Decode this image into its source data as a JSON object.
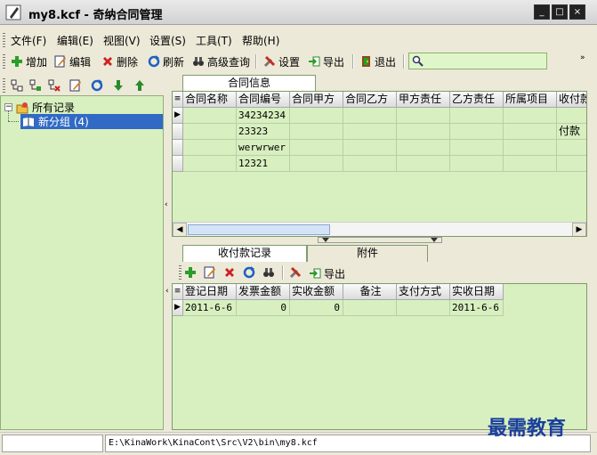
{
  "window": {
    "title": "my8.kcf - 奇纳合同管理"
  },
  "menu": [
    "文件(F)",
    "编辑(E)",
    "视图(V)",
    "设置(S)",
    "工具(T)",
    "帮助(H)"
  ],
  "toolbar": {
    "add": "增加",
    "edit": "编辑",
    "delete": "删除",
    "refresh": "刷新",
    "advanced_search": "高级查询",
    "settings": "设置",
    "export": "导出",
    "exit": "退出"
  },
  "tree": {
    "root": "所有记录",
    "group": "新分组 (4)"
  },
  "top_panel": {
    "tab": "合同信息",
    "columns": [
      "合同名称",
      "合同编号",
      "合同甲方",
      "合同乙方",
      "甲方责任",
      "乙方责任",
      "所属项目",
      "收付款"
    ],
    "rows": [
      [
        "",
        "34234234",
        "",
        "",
        "",
        "",
        "",
        ""
      ],
      [
        "",
        "23323",
        "",
        "",
        "",
        "",
        "",
        "付款"
      ],
      [
        "",
        "werwrwer",
        "",
        "",
        "",
        "",
        "",
        ""
      ],
      [
        "",
        "12321",
        "",
        "",
        "",
        "",
        "",
        ""
      ]
    ]
  },
  "bottom_panel": {
    "tabs": [
      "收付款记录",
      "附件"
    ],
    "export": "导出",
    "columns": [
      "登记日期",
      "发票金额",
      "实收金额",
      "备注",
      "支付方式",
      "实收日期"
    ],
    "rows": [
      [
        "2011-6-6",
        "0",
        "0",
        "",
        "",
        "2011-6-6"
      ]
    ]
  },
  "status": {
    "path": "E:\\KinaWork\\KinaCont\\Src\\V2\\bin\\my8.kcf"
  },
  "watermark": "最需教育"
}
